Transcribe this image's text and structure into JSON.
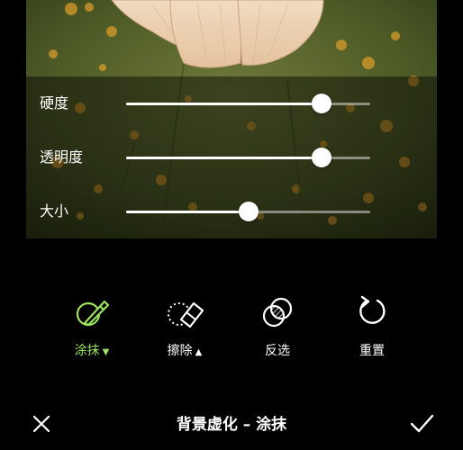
{
  "sliders": [
    {
      "label": "硬度",
      "value": 0.8
    },
    {
      "label": "透明度",
      "value": 0.8
    },
    {
      "label": "大小",
      "value": 0.5
    }
  ],
  "tools": [
    {
      "label": "涂抹",
      "icon": "brush-icon",
      "indicator": "▼",
      "active": true
    },
    {
      "label": "擦除",
      "icon": "eraser-icon",
      "indicator": "▲",
      "active": false
    },
    {
      "label": "反选",
      "icon": "invert-selection-icon",
      "indicator": "",
      "active": false
    },
    {
      "label": "重置",
      "icon": "reset-icon",
      "indicator": "",
      "active": false
    }
  ],
  "bottom_bar": {
    "title": "背景虚化 – 涂抹",
    "close_icon": "close-icon",
    "confirm_icon": "check-icon"
  },
  "colors": {
    "accent": "#9be15d",
    "background": "#000000"
  }
}
